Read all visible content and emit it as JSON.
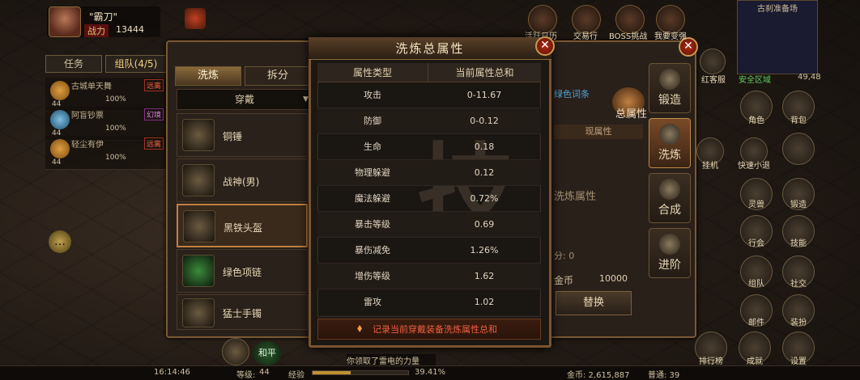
{
  "player": {
    "name": "\"霸刀\"",
    "power_label": "战力",
    "power_value": "13444"
  },
  "quest_tabs": [
    "任务",
    "组队(4/5)"
  ],
  "team": [
    {
      "name": "古城单天舞",
      "level": "44",
      "pct": "100%",
      "badge": "远离"
    },
    {
      "name": "阿盲钞票",
      "level": "44",
      "pct": "100%",
      "badge": "幻境"
    },
    {
      "name": "轻尘有伊",
      "level": "44",
      "pct": "100%",
      "badge": "远离"
    }
  ],
  "panel": {
    "tabs": [
      "洗炼",
      "拆分"
    ],
    "filter": "穿戴",
    "items": [
      "铜锤",
      "战神(男)",
      "黑铁头盔",
      "绿色项链",
      "猛士手镯"
    ],
    "right_buttons": [
      "锻造",
      "洗炼",
      "合成",
      "进阶"
    ],
    "right_header": "总属性",
    "color_strip": "绿色词条",
    "cur_attr": "现属性",
    "wash_attr": "洗炼属性",
    "points": "分: 0",
    "gold_label": "金币",
    "gold_value": "10000",
    "swap_label": "替换"
  },
  "popup": {
    "title": "洗炼总属性",
    "col_type": "属性类型",
    "col_total": "当前属性总和",
    "rows": [
      {
        "type": "攻击",
        "value": "0-11.67"
      },
      {
        "type": "防御",
        "value": "0-0.12"
      },
      {
        "type": "生命",
        "value": "0.18"
      },
      {
        "type": "物理躲避",
        "value": "0.12"
      },
      {
        "type": "魔法躲避",
        "value": "0.72%"
      },
      {
        "type": "暴击等级",
        "value": "0.69"
      },
      {
        "type": "暴伤减免",
        "value": "1.26%"
      },
      {
        "type": "增伤等级",
        "value": "1.62"
      },
      {
        "type": "雷攻",
        "value": "1.02"
      }
    ],
    "footer": "记录当前穿戴装备洗炼属性总和"
  },
  "hud": {
    "top": [
      "活跃日历",
      "交易行",
      "BOSS挑战",
      "我要变强"
    ],
    "map_title": "古刹准备场",
    "safe": "安全区域",
    "coord": "49,48",
    "right": [
      "角色",
      "背包",
      "挂机",
      "快速小退",
      "灵兽",
      "锻造",
      "行会",
      "技能",
      "组队",
      "社交",
      "邮件",
      "装扮",
      "排行榜",
      "成就",
      "设置"
    ],
    "misc": [
      "红客服"
    ]
  },
  "bottom": {
    "time": "16:14:46",
    "level_label": "等级:",
    "level": "44",
    "exp_label": "经验",
    "exp_pct": "39.41%",
    "exp_fraction": 0.3941,
    "gold": "金币: 2,615,887",
    "region": "普通: 39",
    "chat": "你领取了雷电的力量",
    "peace": "和平"
  }
}
